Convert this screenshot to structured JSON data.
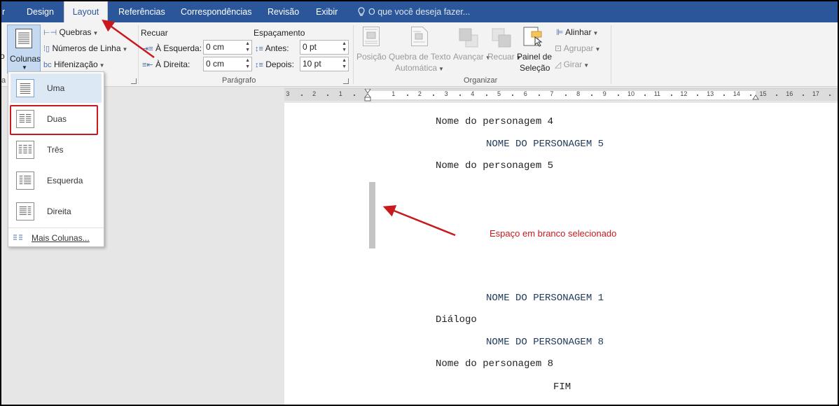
{
  "tabs": [
    {
      "label": "r"
    },
    {
      "label": "Design"
    },
    {
      "label": "Layout"
    },
    {
      "label": "Referências"
    },
    {
      "label": "Correspondências"
    },
    {
      "label": "Revisão"
    },
    {
      "label": "Exibir"
    }
  ],
  "tell_me": "O que você deseja fazer...",
  "ribbon": {
    "colunas_label": "Colunas",
    "o_label": "o",
    "quebras": "Quebras",
    "numeros_linha": "Números de Linha",
    "hifenizacao": "Hifenização",
    "recuar_label": "Recuar",
    "esquerda_label": "À Esquerda:",
    "esquerda_value": "0 cm",
    "direita_label": "À Direita:",
    "direita_value": "0 cm",
    "espacamento_label": "Espaçamento",
    "antes_label": "Antes:",
    "antes_value": "0 pt",
    "depois_label": "Depois:",
    "depois_value": "10 pt",
    "paragrafo_group": "Parágrafo",
    "posicao": "Posição",
    "quebra_texto_1": "Quebra de Texto",
    "quebra_texto_2": "Automática",
    "avancar": "Avançar",
    "recuar": "Recuar",
    "painel_1": "Painel de",
    "painel_2": "Seleção",
    "organizar_group": "Organizar",
    "alinhar": "Alinhar",
    "agrupar": "Agrupar",
    "girar": "Girar",
    "left_group_partial": "a"
  },
  "dropdown": {
    "items": [
      {
        "label": "Uma"
      },
      {
        "label": "Duas"
      },
      {
        "label": "Três"
      },
      {
        "label": "Esquerda"
      },
      {
        "label": "Direita"
      }
    ],
    "more": "Mais Colunas..."
  },
  "ruler_labels": [
    "3",
    "2",
    "1",
    "1",
    "2",
    "3",
    "4",
    "5",
    "6",
    "7",
    "8",
    "9",
    "10",
    "11",
    "12",
    "13",
    "14",
    "15",
    "16",
    "17"
  ],
  "document": {
    "lines": [
      {
        "text": "Nome do personagem 4",
        "kind": "dialog"
      },
      {
        "text": "NOME DO PERSONAGEM 5",
        "kind": "name"
      },
      {
        "text": "Nome do personagem 5",
        "kind": "dialog"
      },
      {
        "text": "NOME DO PERSONAGEM 1",
        "kind": "name"
      },
      {
        "text": "Diálogo",
        "kind": "dialog"
      },
      {
        "text": "NOME DO PERSONAGEM 8",
        "kind": "name"
      },
      {
        "text": "Nome do personagem 8",
        "kind": "dialog"
      },
      {
        "text": "FIM",
        "kind": "end"
      }
    ],
    "annotation": "Espaço em branco selecionado"
  },
  "colors": {
    "tab_bar": "#2b579a",
    "annotation_red": "#c8191e"
  }
}
